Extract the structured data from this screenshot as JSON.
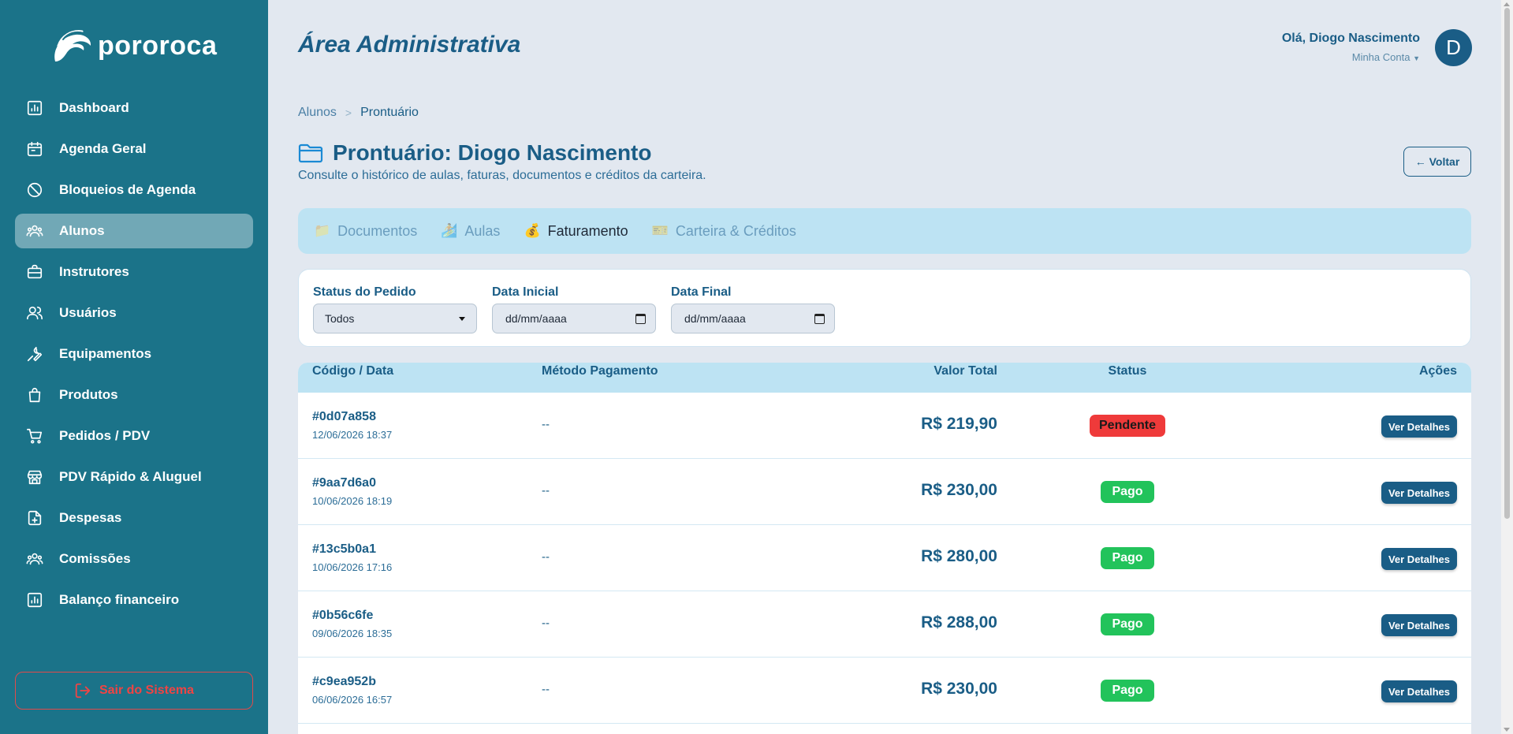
{
  "sidebar": {
    "logo_text": "pororoca",
    "items": [
      {
        "label": "Dashboard",
        "icon": "chart-icon"
      },
      {
        "label": "Agenda Geral",
        "icon": "calendar-icon"
      },
      {
        "label": "Bloqueios de Agenda",
        "icon": "ban-icon"
      },
      {
        "label": "Alunos",
        "icon": "group-icon"
      },
      {
        "label": "Instrutores",
        "icon": "briefcase-icon"
      },
      {
        "label": "Usuários",
        "icon": "users-icon"
      },
      {
        "label": "Equipamentos",
        "icon": "wrench-icon"
      },
      {
        "label": "Produtos",
        "icon": "bag-icon"
      },
      {
        "label": "Pedidos / PDV",
        "icon": "cart-icon"
      },
      {
        "label": "PDV Rápido & Aluguel",
        "icon": "store-icon"
      },
      {
        "label": "Despesas",
        "icon": "file-plus-icon"
      },
      {
        "label": "Comissões",
        "icon": "group-icon"
      },
      {
        "label": "Balanço financeiro",
        "icon": "chart-icon"
      }
    ],
    "active": "Alunos",
    "logout_label": "Sair do Sistema"
  },
  "header": {
    "title": "Área Administrativa",
    "greeting": "Olá, Diogo Nascimento",
    "account_label": "Minha Conta",
    "avatar_letter": "D"
  },
  "breadcrumb": {
    "parent": "Alunos",
    "separator": ">",
    "current": "Prontuário"
  },
  "page": {
    "title": "Prontuário: Diogo Nascimento",
    "subtitle": "Consulte o histórico de aulas, faturas, documentos e créditos da carteira.",
    "back_label": "← Voltar"
  },
  "tabs": [
    {
      "label": "Documentos",
      "icon": "📁"
    },
    {
      "label": "Aulas",
      "icon": "🏄"
    },
    {
      "label": "Faturamento",
      "icon": "💰"
    },
    {
      "label": "Carteira & Créditos",
      "icon": "🎫"
    }
  ],
  "active_tab": "Faturamento",
  "filters": {
    "status_label": "Status do Pedido",
    "status_value": "Todos",
    "start_label": "Data Inicial",
    "start_value": "dd/mm/aaaa",
    "end_label": "Data Final",
    "end_value": "dd/mm/aaaa"
  },
  "table": {
    "headers": {
      "code": "Código / Data",
      "method": "Método Pagamento",
      "total": "Valor Total",
      "status": "Status",
      "actions": "Ações"
    },
    "action_label": "Ver Detalhes",
    "rows": [
      {
        "code": "#0d07a858",
        "date": "12/06/2026 18:37",
        "method": "--",
        "total": "R$ 219,90",
        "status": "Pendente"
      },
      {
        "code": "#9aa7d6a0",
        "date": "10/06/2026 18:19",
        "method": "--",
        "total": "R$ 230,00",
        "status": "Pago"
      },
      {
        "code": "#13c5b0a1",
        "date": "10/06/2026 17:16",
        "method": "--",
        "total": "R$ 280,00",
        "status": "Pago"
      },
      {
        "code": "#0b56c6fe",
        "date": "09/06/2026 18:35",
        "method": "--",
        "total": "R$ 288,00",
        "status": "Pago"
      },
      {
        "code": "#c9ea952b",
        "date": "06/06/2026 16:57",
        "method": "--",
        "total": "R$ 230,00",
        "status": "Pago"
      }
    ]
  },
  "colors": {
    "sidebar_bg": "#1b7389",
    "primary": "#1a5d86",
    "pending": "#ef3a3a",
    "paid": "#22c35b",
    "tabs_bg": "#bde3f3"
  }
}
